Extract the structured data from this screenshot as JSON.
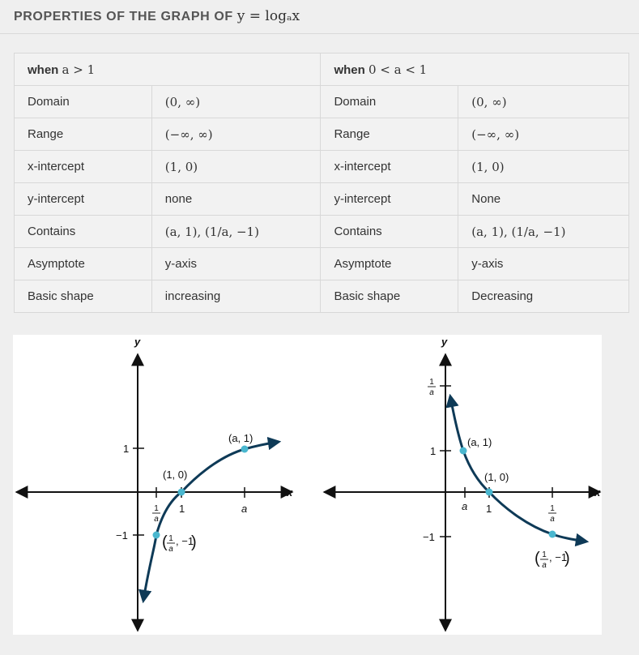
{
  "title": {
    "prefix": "PROPERTIES OF THE GRAPH OF ",
    "math": "y = logₐx"
  },
  "table": {
    "headers": [
      {
        "prefix": "when ",
        "math": "a > 1"
      },
      {
        "prefix": "when ",
        "math": "0 < a < 1"
      }
    ],
    "rows": [
      {
        "label_a": "Domain",
        "value_a": "(0, ∞)",
        "label_b": "Domain",
        "value_b": "(0, ∞)",
        "math_a": true,
        "math_b": true
      },
      {
        "label_a": "Range",
        "value_a": "(−∞, ∞)",
        "label_b": "Range",
        "value_b": "(−∞, ∞)",
        "math_a": true,
        "math_b": true
      },
      {
        "label_a": "x-intercept",
        "value_a": "(1, 0)",
        "label_b": "x-intercept",
        "value_b": "(1, 0)",
        "math_a": true,
        "math_b": true
      },
      {
        "label_a": "y-intercept",
        "value_a": "none",
        "label_b": "y-intercept",
        "value_b": "None",
        "math_a": false,
        "math_b": false
      },
      {
        "label_a": "Contains",
        "value_a": "(a, 1), (1/a, −1)",
        "label_b": "Contains",
        "value_b": "(a, 1), (1/a, −1)",
        "math_a": true,
        "math_b": true
      },
      {
        "label_a": "Asymptote",
        "value_a": "y-axis",
        "label_b": "Asymptote",
        "value_b": "y-axis",
        "math_a": false,
        "math_b": false
      },
      {
        "label_a": "Basic shape",
        "value_a": "increasing",
        "label_b": "Basic shape",
        "value_b": "Decreasing",
        "math_a": false,
        "math_b": false
      }
    ]
  },
  "graphs": {
    "left": {
      "x_axis_label": "x",
      "y_axis_label": "y",
      "y_tick_labels": [
        "1",
        "−1"
      ],
      "x_tick_labels": [
        "1/a",
        "1",
        "a"
      ],
      "points": [
        {
          "label": "(a, 1)"
        },
        {
          "label": "(1, 0)"
        },
        {
          "label": "(1/a, −1)"
        }
      ]
    },
    "right": {
      "x_axis_label": "x",
      "y_axis_label": "y",
      "y_tick_labels": [
        "1/a",
        "1",
        "−1"
      ],
      "x_tick_labels": [
        "a",
        "1",
        "1/a"
      ],
      "points": [
        {
          "label": "(a, 1)"
        },
        {
          "label": "(1, 0)"
        },
        {
          "label": "(1/a, −1)"
        }
      ]
    },
    "colors": {
      "curve": "#0e3a57",
      "point": "#4ab7cf",
      "axis": "#111111"
    }
  }
}
